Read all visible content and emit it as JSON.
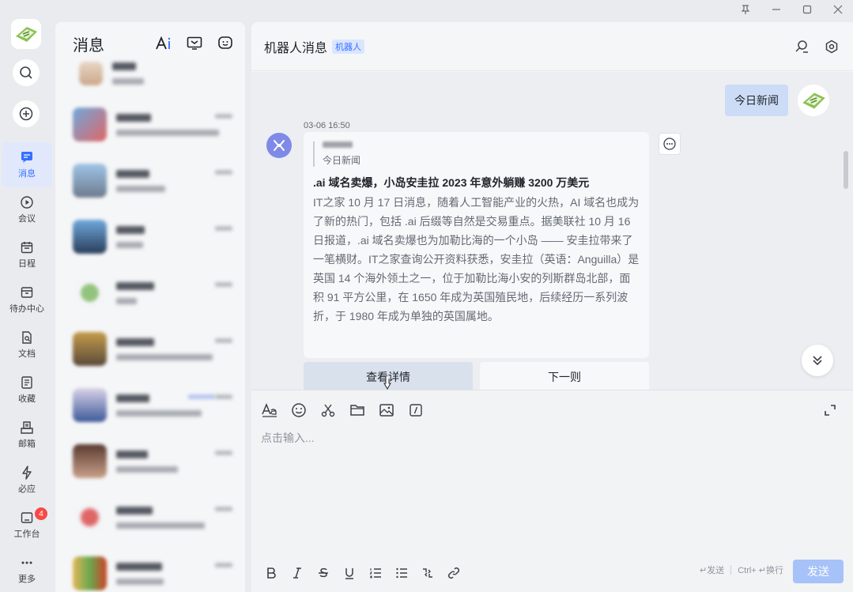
{
  "window": {
    "controls": [
      "pin",
      "minimize",
      "maximize",
      "close"
    ]
  },
  "rail": {
    "nav": [
      {
        "label": "消息",
        "icon": "message-icon",
        "active": true
      },
      {
        "label": "会议",
        "icon": "meeting-icon"
      },
      {
        "label": "日程",
        "icon": "calendar-icon"
      },
      {
        "label": "待办中心",
        "icon": "todo-icon"
      },
      {
        "label": "文档",
        "icon": "docs-icon"
      },
      {
        "label": "收藏",
        "icon": "favorites-icon"
      },
      {
        "label": "邮箱",
        "icon": "mail-icon"
      },
      {
        "label": "必应",
        "icon": "lightning-icon"
      },
      {
        "label": "工作台",
        "icon": "workbench-icon",
        "badge": "4"
      },
      {
        "label": "更多",
        "icon": "more-icon"
      }
    ]
  },
  "convlist": {
    "title": "消息"
  },
  "chat": {
    "name": "机器人消息",
    "tag": "机器人",
    "user_message": "今日新闻",
    "timestamp": "03-06 16:50",
    "card": {
      "quote_text": "今日新闻",
      "title": ".ai 域名卖爆，小岛安圭拉 2023 年意外躺赚 3200 万美元",
      "body": "IT之家 10 月 17 日消息，随着人工智能产业的火热，AI 域名也成为了新的热门，包括 .ai 后缀等自然是交易重点。据美联社 10 月 16 日报道，.ai 域名卖爆也为加勒比海的一个小岛 —— 安圭拉带来了一笔横财。IT之家查询公开资料获悉，安圭拉（英语：Anguilla）是英国 14 个海外领土之一，位于加勒比海小安的列斯群岛北部，面积 91 平方公里，在 1650 年成为英国殖民地，后续经历一系列波折，于 1980 年成为单独的英国属地。",
      "primary_action": "查看详情",
      "secondary_action": "下一则"
    },
    "composer": {
      "placeholder": "点击输入...",
      "send_hint": "↵发送",
      "newline_hint": "Ctrl+ ↵换行",
      "send_label": "发送"
    }
  },
  "colors": {
    "accent": "#3370ff",
    "badge": "#f54a45",
    "bot_avatar": "#7f8ae8",
    "send_disabled": "#a6c2f8"
  }
}
